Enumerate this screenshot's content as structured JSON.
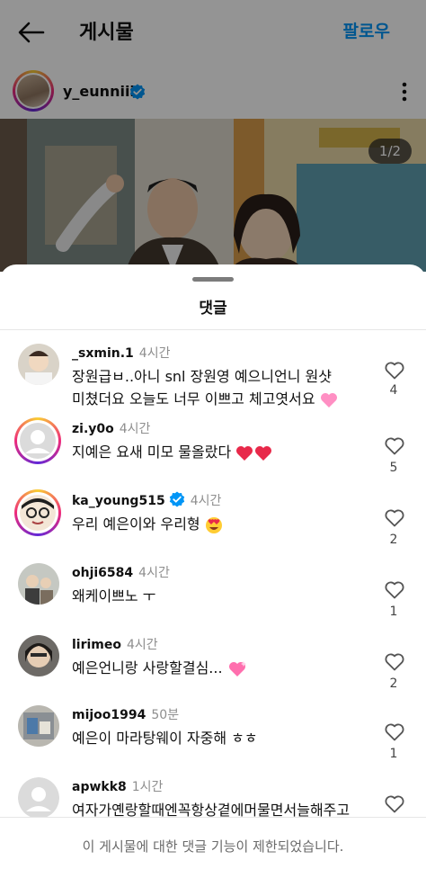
{
  "header": {
    "title": "게시물",
    "follow_label": "팔로우"
  },
  "post": {
    "username": "y_eunniii",
    "image_counter": "1/2"
  },
  "sheet": {
    "title": "댓글"
  },
  "comments": [
    {
      "username": "_sxmin.1",
      "time": "4시간",
      "text_line1": "장원급ㅂ..아니 snl 장원영 예으니언니 원샷",
      "text_line2": "미쳤더요 오늘도 너무 이쁘고 체고엿서요",
      "likes": "4"
    },
    {
      "username": "zi.y0o",
      "time": "4시간",
      "text": "지예은 요새 미모 물올랐다",
      "likes": "5"
    },
    {
      "username": "ka_young515",
      "time": "4시간",
      "text": "우리 예은이와 우리형",
      "likes": "2"
    },
    {
      "username": "ohji6584",
      "time": "4시간",
      "text": "왜케이쁘노 ㅜ",
      "likes": "1"
    },
    {
      "username": "lirimeo",
      "time": "4시간",
      "text": "예은언니랑 사랑할결심...",
      "likes": "2"
    },
    {
      "username": "mijoo1994",
      "time": "50분",
      "text": "예은이 마라탕웨이 자중해 ㅎㅎ",
      "likes": "1"
    },
    {
      "username": "apwkk8",
      "time": "1시간",
      "text": "여자가옌랑할때엔꼭항상곁에머물면서늘해주고"
    }
  ],
  "footer": {
    "notice": "이 게시물에 대한 댓글 기능이 제한되었습니다."
  },
  "colors": {
    "accent": "#0095f6",
    "verified": "#0095f6",
    "emoji_heart": "#e8294a",
    "emoji_pink": "#ff8fc3"
  }
}
